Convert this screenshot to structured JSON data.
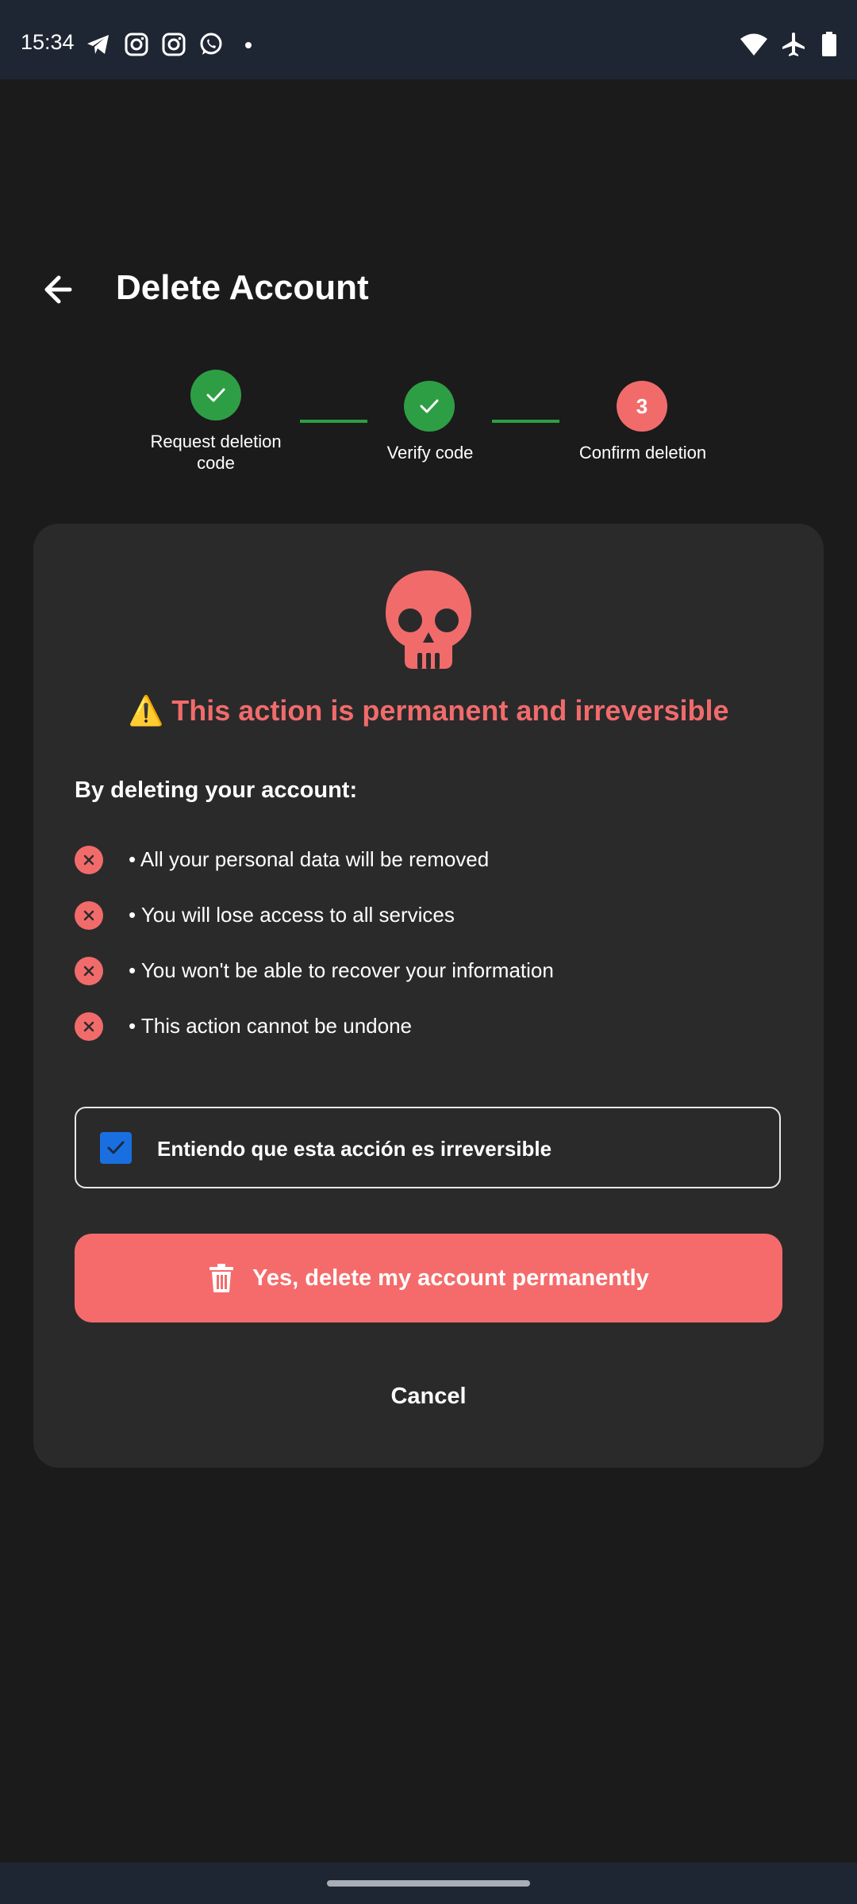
{
  "status_bar": {
    "time": "15:34",
    "icons": [
      "telegram-icon",
      "instagram-icon",
      "instagram-icon",
      "whatsapp-icon",
      "dot-icon",
      "wifi-icon",
      "airplane-icon",
      "battery-icon"
    ]
  },
  "header": {
    "title": "Delete Account",
    "back_icon": "arrow-left-icon"
  },
  "stepper": {
    "steps": [
      {
        "label": "Request deletion code",
        "state": "done"
      },
      {
        "label": "Verify code",
        "state": "done"
      },
      {
        "label": "Confirm deletion",
        "state": "active",
        "number": "3"
      }
    ]
  },
  "card": {
    "icon": "skull-icon",
    "warning_emoji": "⚠️",
    "warning": "This action is permanent and irreversible",
    "subheading": "By deleting your account:",
    "consequences": [
      "• All your personal data will be removed",
      "• You will lose access to all services",
      "• You won't be able to recover your information",
      "• This action cannot be undone"
    ],
    "acknowledge": {
      "label": "Entiendo que esta acción es irreversible",
      "checked": true
    },
    "delete_button": "Yes, delete my account permanently",
    "cancel_button": "Cancel"
  },
  "colors": {
    "background": "#1b1b1c",
    "card": "#2a2a2b",
    "danger": "#f16b6b",
    "success": "#2e9e44",
    "checkbox": "#1a6fe0"
  }
}
